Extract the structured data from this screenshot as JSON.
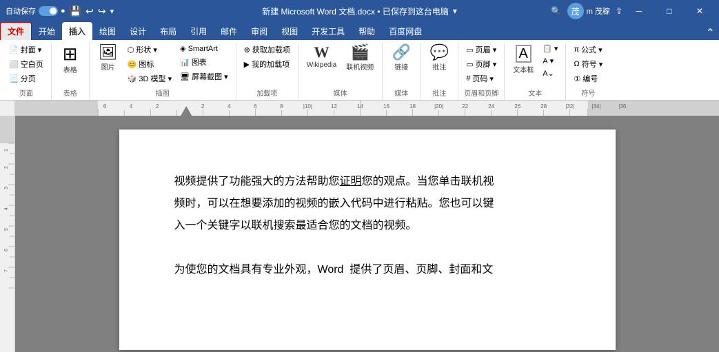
{
  "titleBar": {
    "autosave_label": "自动保存",
    "toggle_state": "on",
    "title": "新建 Microsoft Word 文档.docx • 已保存到这台电脑",
    "search_placeholder": "搜索",
    "username": "m 茂稼",
    "icons": {
      "save": "💾",
      "undo": "↩",
      "redo": "↪",
      "more": "∨"
    }
  },
  "ribbon": {
    "tabs": [
      {
        "id": "file",
        "label": "文件",
        "active": false,
        "highlight": true
      },
      {
        "id": "home",
        "label": "开始",
        "active": false
      },
      {
        "id": "insert",
        "label": "插入",
        "active": true
      },
      {
        "id": "draw",
        "label": "绘图",
        "active": false
      },
      {
        "id": "design",
        "label": "设计",
        "active": false
      },
      {
        "id": "layout",
        "label": "布局",
        "active": false
      },
      {
        "id": "reference",
        "label": "引用",
        "active": false
      },
      {
        "id": "mail",
        "label": "邮件",
        "active": false
      },
      {
        "id": "review",
        "label": "审阅",
        "active": false
      },
      {
        "id": "view",
        "label": "视图",
        "active": false
      },
      {
        "id": "dev",
        "label": "开发工具",
        "active": false
      },
      {
        "id": "help",
        "label": "帮助",
        "active": false
      },
      {
        "id": "baidu",
        "label": "百度网盘",
        "active": false
      }
    ],
    "groups": [
      {
        "id": "pages",
        "label": "页面",
        "items": [
          {
            "id": "cover",
            "icon": "📄",
            "label": "封面▾"
          },
          {
            "id": "blank",
            "icon": "⬜",
            "label": "空白页"
          },
          {
            "id": "break",
            "icon": "📃",
            "label": "分页"
          }
        ]
      },
      {
        "id": "table",
        "label": "表格",
        "items": [
          {
            "id": "table",
            "icon": "⊞",
            "label": "表格"
          }
        ]
      },
      {
        "id": "illustrations",
        "label": "插图",
        "items": [
          {
            "id": "picture",
            "icon": "🖼",
            "label": "图片"
          },
          {
            "id": "shape",
            "label": "形状▾"
          },
          {
            "id": "icon_item",
            "label": "图标"
          },
          {
            "id": "3d",
            "label": "3D 模型▾"
          },
          {
            "id": "smartart",
            "icon": "◈",
            "label": "SmartArt"
          },
          {
            "id": "chart",
            "label": "图表"
          },
          {
            "id": "screenshot",
            "label": "屏幕截图▾"
          }
        ]
      },
      {
        "id": "addins",
        "label": "加载项",
        "items": [
          {
            "id": "getaddin",
            "icon": "⊕",
            "label": "获取加载项"
          },
          {
            "id": "myaddin",
            "icon": "▶",
            "label": "我的加载项"
          }
        ]
      },
      {
        "id": "media",
        "label": "媒体",
        "items": [
          {
            "id": "wikipedia",
            "label": "Wikipedia"
          },
          {
            "id": "video",
            "label": "联机视频"
          }
        ]
      },
      {
        "id": "links",
        "label": "媒体",
        "items": [
          {
            "id": "link",
            "label": "链接"
          }
        ]
      },
      {
        "id": "comments",
        "label": "批注",
        "items": [
          {
            "id": "comment",
            "label": "批注"
          }
        ]
      },
      {
        "id": "headerFooter",
        "label": "页眉和页脚",
        "items": [
          {
            "id": "header",
            "label": "页眉▾"
          },
          {
            "id": "footer",
            "label": "页脚▾"
          },
          {
            "id": "pagenumber",
            "label": "页码▾"
          }
        ]
      },
      {
        "id": "text",
        "label": "文本",
        "items": [
          {
            "id": "textbox",
            "label": "文本框"
          },
          {
            "id": "quickparts",
            "label": ""
          },
          {
            "id": "wordart",
            "label": ""
          },
          {
            "id": "dropcap",
            "label": ""
          },
          {
            "id": "signline",
            "label": ""
          },
          {
            "id": "datetime",
            "label": ""
          },
          {
            "id": "object",
            "label": ""
          }
        ]
      },
      {
        "id": "symbols",
        "label": "符号",
        "items": [
          {
            "id": "equation",
            "label": "π 公式▾"
          },
          {
            "id": "symbol",
            "label": "Ω 符号▾"
          },
          {
            "id": "bianma",
            "label": "编号"
          }
        ]
      }
    ]
  },
  "document": {
    "content": [
      "视频提供了功能强大的方法帮助您证明您的观点。当您单击联机视",
      "频时，可以在想要添加的视频的嵌入代码中进行粘贴。您也可以键",
      "入一个关键字以联机搜索最适合您的文档的视频。",
      "",
      "为使您的文档具有专业外观，Word  提供了页眉、页脚、封面和文"
    ],
    "underline_text": "您证明",
    "link_text": "联机视"
  }
}
